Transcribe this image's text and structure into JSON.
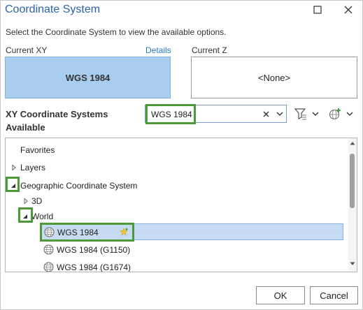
{
  "dialog": {
    "title": "Coordinate System",
    "instructions": "Select the Coordinate System to view the available options."
  },
  "current": {
    "xy_label": "Current XY",
    "details_link": "Details",
    "z_label": "Current Z",
    "xy_value": "WGS 1984",
    "z_value": "<None>"
  },
  "available": {
    "title_line1": "XY Coordinate Systems",
    "title_line2": "Available",
    "search_value": "WGS 1984"
  },
  "tree": {
    "items": [
      {
        "label": "Favorites"
      },
      {
        "label": "Layers"
      },
      {
        "label": "Geographic Coordinate System"
      },
      {
        "label": "3D"
      },
      {
        "label": "World"
      },
      {
        "label": "WGS 1984"
      },
      {
        "label": "WGS 1984 (G1150)"
      },
      {
        "label": "WGS 1984 (G1674)"
      }
    ]
  },
  "buttons": {
    "ok": "OK",
    "cancel": "Cancel"
  },
  "colors": {
    "title": "#2a64a8",
    "highlight": "#4e9a3b",
    "selected_card": "#a9cdef",
    "selected_row": "#c7dcf2"
  }
}
